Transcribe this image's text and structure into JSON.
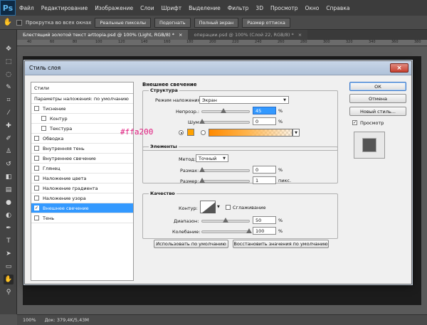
{
  "app": {
    "logo": "Ps",
    "menu": [
      "Файл",
      "Редактирование",
      "Изображение",
      "Слои",
      "Шрифт",
      "Выделение",
      "Фильтр",
      "3D",
      "Просмотр",
      "Окно",
      "Справка"
    ]
  },
  "options_bar": {
    "scroll_all": "Прокрутка во всех окнах",
    "buttons": [
      "Реальные пикселы",
      "Подогнать",
      "Полный экран",
      "Размер оттиска"
    ]
  },
  "tabs": [
    {
      "label": "Блестящий золотой текст  arttopia.psd @ 100% (Light, RGB/8) *",
      "close": "×"
    },
    {
      "label": "операции.psd @ 100% (Слой 22, RGB/8) *",
      "close": "×"
    }
  ],
  "ruler_ticks": [
    "40",
    "60",
    "80",
    "100",
    "120",
    "140",
    "160",
    "180",
    "200",
    "220",
    "240",
    "260",
    "280",
    "300",
    "320",
    "340",
    "360",
    "380"
  ],
  "status": {
    "zoom": "100%",
    "doc": "Док: 379,4K/5,43M"
  },
  "dialog": {
    "title": "Стиль слоя",
    "close": "×",
    "styles_header": "Стили",
    "styles": [
      {
        "label": "Параметры наложения: по умолчанию",
        "checkbox": false,
        "indent": 0,
        "active": false,
        "header": true
      },
      {
        "label": "Тиснение",
        "checkbox": true,
        "checked": false,
        "indent": 0,
        "active": false
      },
      {
        "label": "Контур",
        "checkbox": true,
        "checked": false,
        "indent": 1,
        "active": false
      },
      {
        "label": "Текстура",
        "checkbox": true,
        "checked": false,
        "indent": 1,
        "active": false
      },
      {
        "label": "Обводка",
        "checkbox": true,
        "checked": false,
        "indent": 0,
        "active": false
      },
      {
        "label": "Внутренняя тень",
        "checkbox": true,
        "checked": false,
        "indent": 0,
        "active": false
      },
      {
        "label": "Внутреннее свечение",
        "checkbox": true,
        "checked": false,
        "indent": 0,
        "active": false
      },
      {
        "label": "Глянец",
        "checkbox": true,
        "checked": false,
        "indent": 0,
        "active": false
      },
      {
        "label": "Наложение цвета",
        "checkbox": true,
        "checked": false,
        "indent": 0,
        "active": false
      },
      {
        "label": "Наложение градиента",
        "checkbox": true,
        "checked": false,
        "indent": 0,
        "active": false
      },
      {
        "label": "Наложение узора",
        "checkbox": true,
        "checked": false,
        "indent": 0,
        "active": false
      },
      {
        "label": "Внешнее свечение",
        "checkbox": true,
        "checked": true,
        "indent": 0,
        "active": true
      },
      {
        "label": "Тень",
        "checkbox": true,
        "checked": false,
        "indent": 0,
        "active": false
      }
    ],
    "panel_title": "Внешнее свечение",
    "structure": {
      "title": "Структура",
      "blend_mode_label": "Режим наложения:",
      "blend_mode": "Экран",
      "opacity_label": "Непрозр.:",
      "opacity": "45",
      "opacity_fraction": 0.45,
      "noise_label": "Шум:",
      "noise": "0",
      "noise_fraction": 0.0,
      "percent": "%",
      "hex_annotation": "#ffa200",
      "color": "#ffa200"
    },
    "elements": {
      "title": "Элементы",
      "method_label": "Метод:",
      "method": "Точный",
      "spread_label": "Размах:",
      "spread": "0",
      "spread_fraction": 0.0,
      "size_label": "Размер:",
      "size": "1",
      "size_fraction": 0.005,
      "percent": "%",
      "px_unit": "пикс."
    },
    "quality": {
      "title": "Качество",
      "contour_label": "Контур:",
      "antialias_label": "Сглаживание",
      "range_label": "Диапазон:",
      "range": "50",
      "range_fraction": 0.5,
      "jitter_label": "Колебание:",
      "jitter": "100",
      "jitter_fraction": 1.0,
      "percent": "%"
    },
    "btn_make_default": "Использовать по умолчанию",
    "btn_reset_default": "Восстановить значения по умолчанию",
    "btn_ok": "ОК",
    "btn_cancel": "Отмена",
    "btn_new_style": "Новый стиль...",
    "preview_label": "Просмотр",
    "preview_checked": true
  }
}
